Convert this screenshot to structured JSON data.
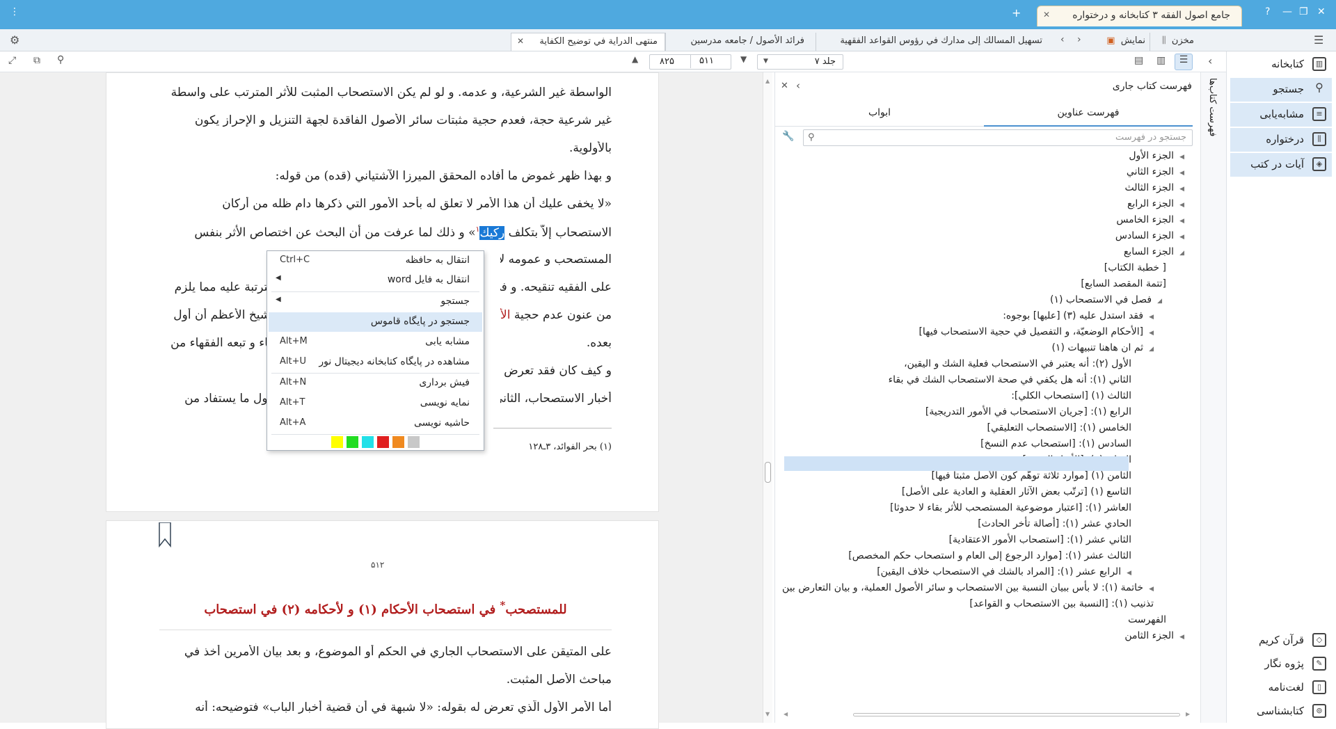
{
  "titlebar": {
    "doc_tab": "جامع اصول الفقه ۳ کتابخانه و درختواره",
    "add_tab": "+",
    "help": "?",
    "menu_glyph": "⋮"
  },
  "book_tabs": [
    {
      "label": "منتهى الدراية في توضيح الكفاية",
      "active": true
    },
    {
      "label": "فرائد الأصول / جامعه مدرسين",
      "active": false
    },
    {
      "label": "تسهيل المسالك إلى مدارك في رؤوس القواعد الفقهية",
      "active": false
    }
  ],
  "view_tabs": {
    "display": "نمایش",
    "archive": "مخزن"
  },
  "toolbar": {
    "volume": "جلد ۷",
    "page_from": "۵۱۱",
    "page_to": "۸۲۵"
  },
  "sidebar": {
    "side_label": "فهرست کتاب‌ها",
    "items": [
      {
        "label": "کتابخانه",
        "icon": "library-icon"
      },
      {
        "label": "جستجو",
        "icon": "search-icon"
      },
      {
        "label": "مشابه‌یابی",
        "icon": "similar-icon"
      },
      {
        "label": "درختواره",
        "icon": "tree-icon"
      },
      {
        "label": "آیات در کتب",
        "icon": "verses-icon"
      }
    ],
    "bottom_items": [
      {
        "label": "قرآن کریم",
        "icon": "quran-icon"
      },
      {
        "label": "پژوه نگار",
        "icon": "research-icon"
      },
      {
        "label": "لغت‌نامه",
        "icon": "dictionary-icon"
      },
      {
        "label": "کتابشناسی",
        "icon": "bibliography-icon"
      }
    ]
  },
  "toc": {
    "title": "فهرست کتاب جاری",
    "tab_titles": "فهرست عناوین",
    "tab_chapters": "ابواب",
    "search_placeholder": "جستجو در فهرست",
    "rows": [
      {
        "text": "الجزء الأول",
        "level": 0,
        "tri": "◀"
      },
      {
        "text": "الجزء الثاني",
        "level": 0,
        "tri": "◀"
      },
      {
        "text": "الجزء الثالث",
        "level": 0,
        "tri": "◀"
      },
      {
        "text": "الجزء الرابع",
        "level": 0,
        "tri": "◀"
      },
      {
        "text": "الجزء الخامس",
        "level": 0,
        "tri": "◀"
      },
      {
        "text": "الجزء السادس",
        "level": 0,
        "tri": "◀"
      },
      {
        "text": "الجزء السابع",
        "level": 0,
        "tri": "◢"
      },
      {
        "text": "[ خطبة الكتاب]",
        "level": 1,
        "tri": ""
      },
      {
        "text": "[تتمة المقصد السابع]",
        "level": 1,
        "tri": ""
      },
      {
        "text": "فصل في الاستصحاب (١)",
        "level": 2,
        "tri": "◢"
      },
      {
        "text": "فقد استدل عليه (٣) [عليها] بوجوه:",
        "level": 3,
        "tri": "◀"
      },
      {
        "text": "[الأحكام الوضعيّة، و التفصيل في حجية الاستصحاب فيها]",
        "level": 3,
        "tri": "◀"
      },
      {
        "text": "ثم ان هاهنا تنبيهات (١)",
        "level": 3,
        "tri": "◢"
      },
      {
        "text": "الأول (٢): أنه يعتبر في الاستصحاب فعلية الشك و اليقين،",
        "level": 4,
        "tri": ""
      },
      {
        "text": "الثاني (١): أنه هل يكفي في صحة الاستصحاب الشك في بقاء",
        "level": 4,
        "tri": ""
      },
      {
        "text": "الثالث (١) [استصحاب الكلي]:",
        "level": 4,
        "tri": ""
      },
      {
        "text": "الرابع (١): [جريان الاستصحاب في الأمور التدريجية]",
        "level": 4,
        "tri": ""
      },
      {
        "text": "الخامس (١): [الاستصحاب التعليقي]",
        "level": 4,
        "tri": ""
      },
      {
        "text": "السادس (١): [استصحاب عدم النسخ]",
        "level": 4,
        "tri": ""
      },
      {
        "text": "السابع (١): [الأصل المثبت]",
        "level": 4,
        "tri": "",
        "selected": true
      },
      {
        "text": "الثامن (١) [موارد ثلاثة توهّم كون الأصل مثبتا فيها]",
        "level": 4,
        "tri": ""
      },
      {
        "text": "التاسع (١) [ترتّب بعض الآثار العقلية و العادية على الأصل]",
        "level": 4,
        "tri": ""
      },
      {
        "text": "العاشر (١): [اعتبار موضوعية المستصحب للأثر بقاء لا حدوثا]",
        "level": 4,
        "tri": ""
      },
      {
        "text": "الحادي عشر (١): [أصالة تأخر الحادث]",
        "level": 4,
        "tri": ""
      },
      {
        "text": "الثاني عشر (١): [استصحاب الأمور الاعتقادية]",
        "level": 4,
        "tri": ""
      },
      {
        "text": "الثالث عشر (١): [موارد الرجوع إلى العام و استصحاب حكم المخصص]",
        "level": 4,
        "tri": ""
      },
      {
        "text": "الرابع عشر (١): [المراد بالشك في الاستصحاب خلاف اليقين]",
        "level": 4,
        "tri": "◀"
      },
      {
        "text": "خاتمة (١): لا بأس ببيان النسبة بين الاستصحاب و سائر الأصول العملية، و بيان التعارض بين",
        "level": 3,
        "tri": "◀"
      },
      {
        "text": "تذنيب (١): [النسبة بين الاستصحاب و القواعد]",
        "level": 3,
        "tri": ""
      },
      {
        "text": "الفهرست",
        "level": 1,
        "tri": ""
      },
      {
        "text": "الجزء الثامن",
        "level": 0,
        "tri": "◀"
      }
    ]
  },
  "reader": {
    "page1_lines": [
      "الواسطة غير الشرعية، و عدمه. و لو لم يكن الاستصحاب المثبت للأثر المترتب على واسطة",
      "غير شرعية حجة، فعدم حجية مثبتات سائر الأصول الفاقدة لجهة التنزيل و الإحراز يكون",
      "بالأولوية.",
      "و بهذا ظهر غموض ما أفاده المحقق الميرزا الآشتياني (قده) من قوله:",
      "«لا يخفى عليك أن هذا الأمر لا تعلق له بأحد الأمور التي ذكرها دام ظله من أركان"
    ],
    "line6_pre": "الاستصحاب إلاّ بتكلف ",
    "line6_hl": "ركيك",
    "line6_post": "» و ذلك لما عرفت من أن البحث عن اختصاص الأثر بنفس",
    "footnote_mark": "١",
    "page1_right_frag": [
      "المستصحب و عمومه لأ",
      "على الفقيه تنقيحه. و في",
      "من عنون عدم حجية ",
      "بعده.",
      "و كيف كان فقد تعرض",
      "أخبار الاستصحاب، الثاني"
    ],
    "page1_right_red": "الأ",
    "page1_left_frag": [
      "",
      "سترتبة عليه مما يلزم",
      "الشيخ الأعظم أن أول",
      "طاء و تبعه الفقهاء من",
      "",
      "الأول ما يستفاد من"
    ],
    "footnote": "(١) بحر الفوائد، ٣ـ١٢٨",
    "page2_number": "۵۱۲",
    "page2_heading_pre": "للمستصحب",
    "page2_heading_star": "*",
    "page2_heading_post": " في استصحاب الأحكام (١) و لأحكامه (٢) في استصحاب",
    "page2_lines": [
      "على المتيقن على الاستصحاب الجاري في الحكم أو الموضوع، و بعد بيان الأمرين أخذ في",
      "مباحث الأصل المثبت.",
      "أما الأمر الأول الّذي تعرض له بقوله: «لا شبهة في أن قضية أخبار الباب» فتوضيحه: أنه"
    ]
  },
  "context_menu": {
    "items": [
      {
        "label": "انتقال به حافظه",
        "shortcut": "Ctrl+C",
        "submenu": false
      },
      {
        "label": "انتقال به فایل word",
        "shortcut": "",
        "submenu": true
      },
      {
        "label": "جستجو",
        "shortcut": "",
        "submenu": true
      },
      {
        "label": "جستجو در پایگاه قاموس",
        "shortcut": "",
        "submenu": false,
        "hover": true
      },
      {
        "label": "مشابه یابی",
        "shortcut": "Alt+M",
        "submenu": false
      },
      {
        "label": "مشاهده در پایگاه کتابخانه دیجیتال نور",
        "shortcut": "Alt+U",
        "submenu": false
      },
      {
        "label": "فیش برداری",
        "shortcut": "Alt+N",
        "submenu": false
      },
      {
        "label": "نمایه نویسی",
        "shortcut": "Alt+T",
        "submenu": false
      },
      {
        "label": "حاشیه نویسی",
        "shortcut": "Alt+A",
        "submenu": false
      }
    ],
    "highlight_colors": [
      "#ffff00",
      "#22dd22",
      "#22e0e8",
      "#e02020",
      "#f08a20",
      "#c8c8c8"
    ]
  }
}
